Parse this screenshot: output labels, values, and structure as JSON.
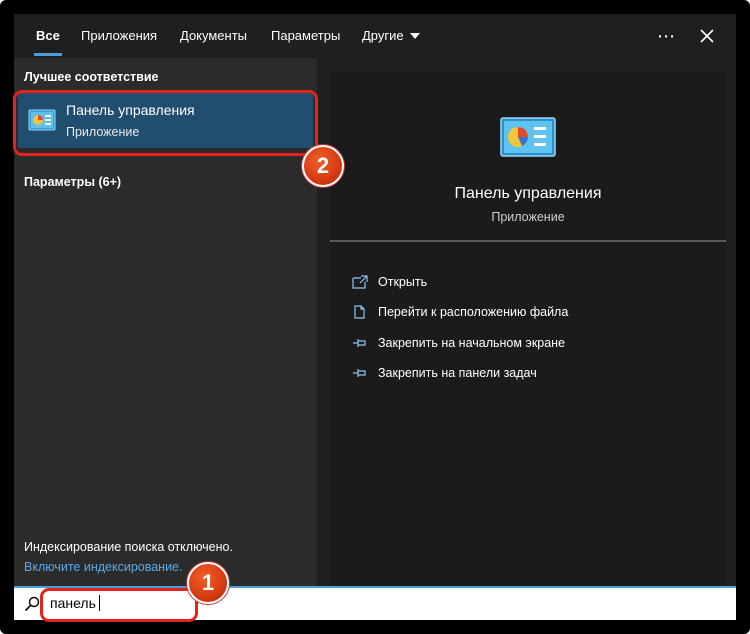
{
  "tabs": [
    {
      "label": "Все",
      "active": true
    },
    {
      "label": "Приложения"
    },
    {
      "label": "Документы"
    },
    {
      "label": "Параметры"
    },
    {
      "label": "Другие"
    }
  ],
  "left": {
    "best_match_header": "Лучшее соответствие",
    "best_match": {
      "title": "Панель управления",
      "subtitle": "Приложение"
    },
    "settings_header": "Параметры (6+)",
    "indexing_off": "Индексирование поиска отключено.",
    "enable_indexing": "Включите индексирование."
  },
  "preview": {
    "title": "Панель управления",
    "subtitle": "Приложение",
    "actions": [
      {
        "label": "Открыть",
        "icon": "open-icon"
      },
      {
        "label": "Перейти к расположению файла",
        "icon": "file-location-icon"
      },
      {
        "label": "Закрепить на начальном экране",
        "icon": "pin-icon"
      },
      {
        "label": "Закрепить на панели задач",
        "icon": "pin-icon"
      }
    ]
  },
  "search": {
    "value": "панель"
  },
  "badges": [
    "1",
    "2"
  ],
  "colors": {
    "accent": "#4a9fe0",
    "highlight": "#214d6e",
    "annotation": "#e2231a"
  }
}
